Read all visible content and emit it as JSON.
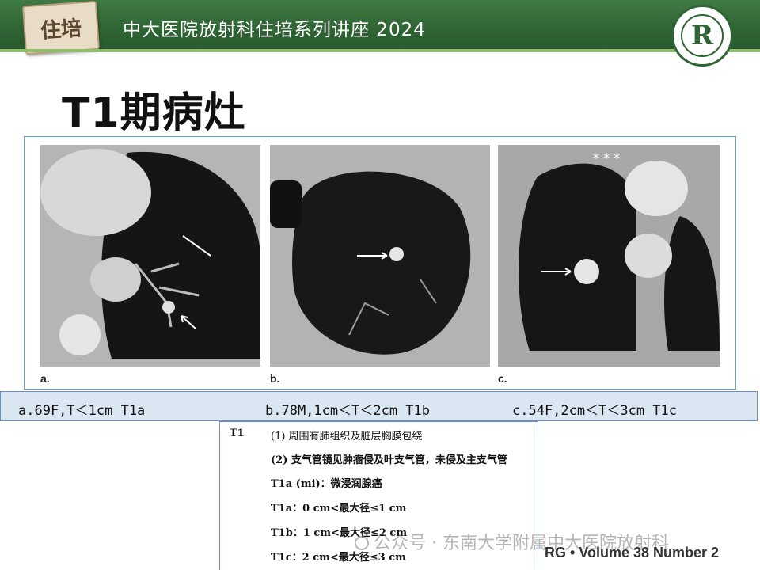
{
  "header": {
    "stamp_text": "住培",
    "title": "中大医院放射科住培系列讲座 2024",
    "logo_letter": "R"
  },
  "slide_title": "T1期病灶",
  "figure": {
    "panels": [
      {
        "letter": "a.",
        "marker": "arrow"
      },
      {
        "letter": "b.",
        "marker": "arrow"
      },
      {
        "letter": "c.",
        "marker": "arrow",
        "extra_marks": "* * *"
      }
    ]
  },
  "caption": {
    "a": "a.69F,T＜1cm T1a",
    "b": "b.78M,1cm＜T＜2cm T1b",
    "c": "c.54F,2cm＜T＜3cm T1c"
  },
  "staging_table": {
    "label": "T1",
    "rows": [
      "(1) 周围有肺组织及脏层胸膜包绕",
      "(2) 支气管镜见肿瘤侵及叶支气管，未侵及主支气管",
      "T1a (mi)：微浸润腺癌",
      "T1a：0 cm<最大径≤1 cm",
      "T1b：1 cm<最大径≤2 cm",
      "T1c：2 cm<最大径≤3 cm"
    ]
  },
  "watermark": "公众号 · 东南大学附属中大医院放射科",
  "journal": "RG • Volume 38  Number 2",
  "colors": {
    "header_green": "#2f6435",
    "caption_bg": "#dbe6f3",
    "border_blue": "#6a8fbf"
  }
}
